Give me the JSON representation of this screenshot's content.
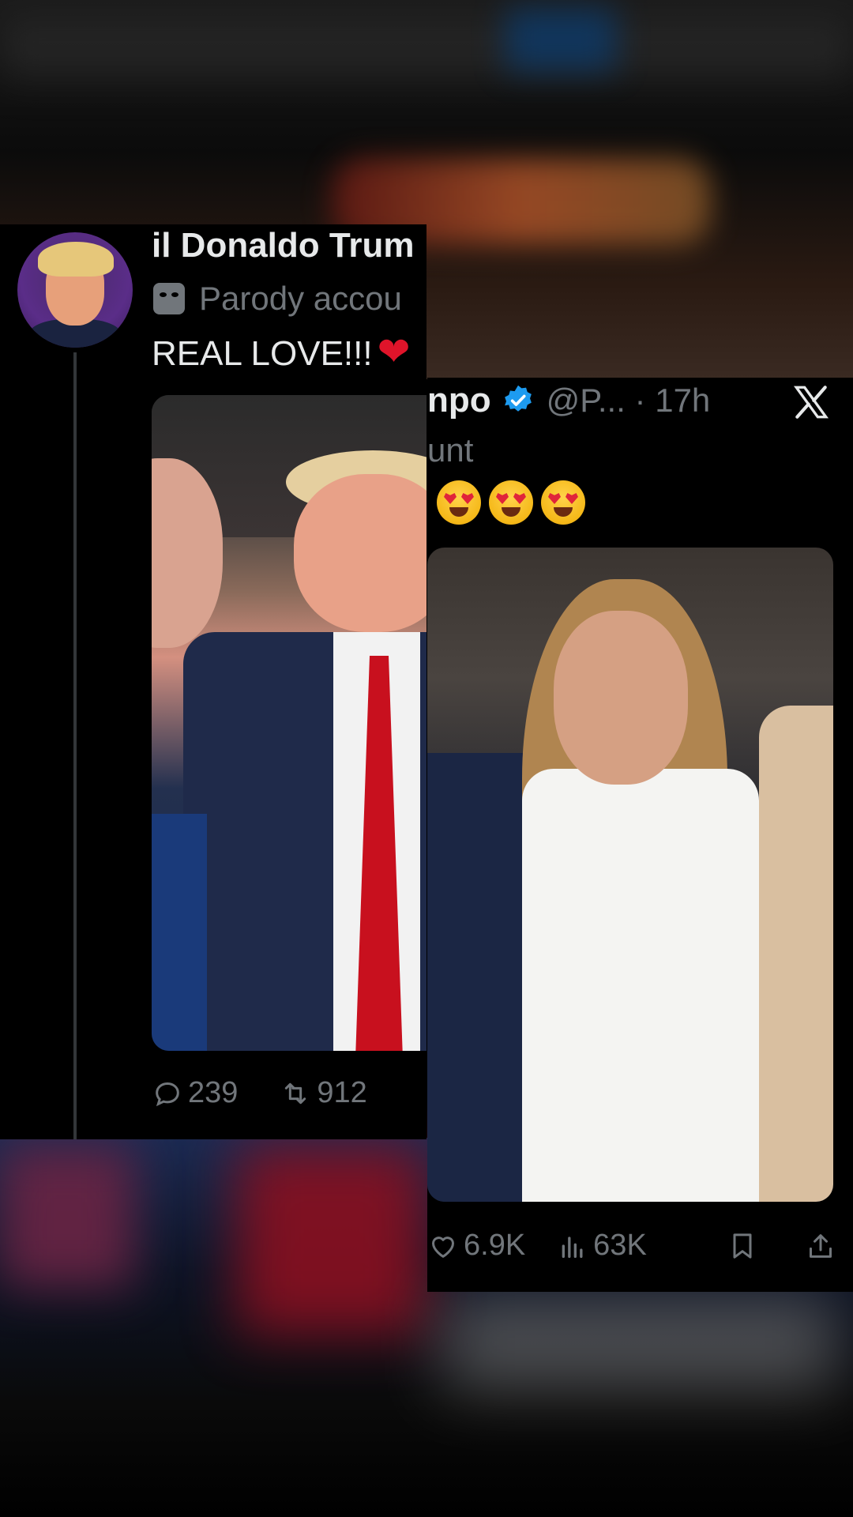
{
  "left_tweet": {
    "display_name": "il Donaldo Trum",
    "badge_text": "Parody accou",
    "text": "REAL LOVE!!!",
    "text_emoji": "❤",
    "stats": {
      "replies": "239",
      "reposts": "912"
    }
  },
  "right_tweet": {
    "display_name": "npo",
    "handle_time": "@P... · 17h",
    "second_line": "unt",
    "emojis": [
      "heart-eyes",
      "heart-eyes",
      "heart-eyes"
    ],
    "stats": {
      "likes": "6.9K",
      "views": "63K"
    }
  },
  "colors": {
    "background": "#000000",
    "text": "#e7e9ea",
    "muted": "#71767b",
    "verified": "#1d9bf0",
    "heart": "#e0142a"
  }
}
